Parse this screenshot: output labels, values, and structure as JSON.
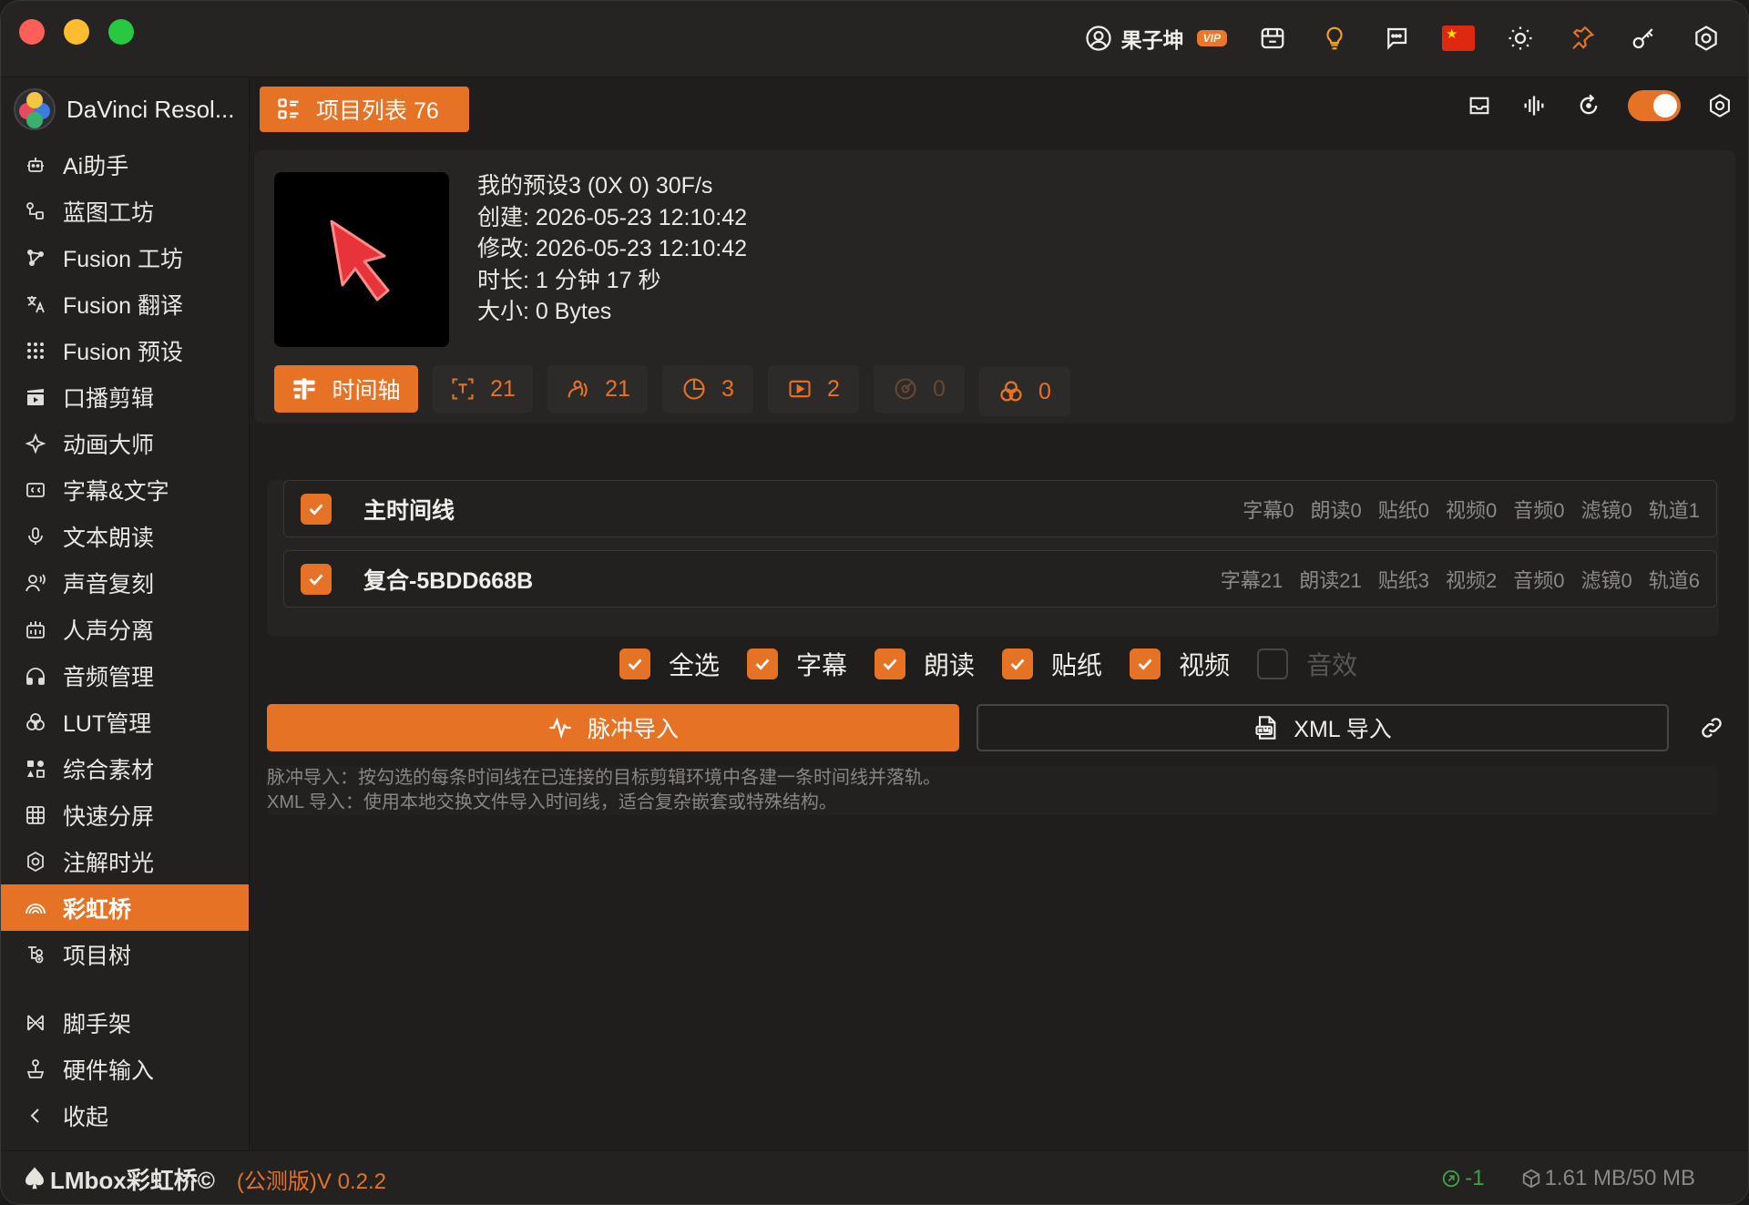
{
  "titlebar": {
    "user_name": "果子坤",
    "vip_label": "VIP"
  },
  "sidebar": {
    "app_name": "DaVinci Resol...",
    "items": [
      {
        "label": "Ai助手",
        "icon": "robot-icon"
      },
      {
        "label": "蓝图工坊",
        "icon": "blueprint-icon"
      },
      {
        "label": "Fusion 工坊",
        "icon": "fusion-workshop-icon"
      },
      {
        "label": "Fusion 翻译",
        "icon": "translate-icon"
      },
      {
        "label": "Fusion 预设",
        "icon": "preset-icon"
      },
      {
        "label": "口播剪辑",
        "icon": "clapper-icon"
      },
      {
        "label": "动画大师",
        "icon": "sparkle-icon"
      },
      {
        "label": "字幕&文字",
        "icon": "caption-icon"
      },
      {
        "label": "文本朗读",
        "icon": "microphone-icon"
      },
      {
        "label": "声音复刻",
        "icon": "voice-clone-icon"
      },
      {
        "label": "人声分离",
        "icon": "separator-icon"
      },
      {
        "label": "音频管理",
        "icon": "headphones-icon"
      },
      {
        "label": "LUT管理",
        "icon": "color-circles-icon"
      },
      {
        "label": "综合素材",
        "icon": "assets-icon"
      },
      {
        "label": "快速分屏",
        "icon": "grid-icon"
      },
      {
        "label": "注解时光",
        "icon": "annotation-icon"
      },
      {
        "label": "彩虹桥",
        "icon": "rainbow-icon"
      },
      {
        "label": "项目树",
        "icon": "tree-icon"
      }
    ],
    "bottom_items": [
      {
        "label": "脚手架",
        "icon": "scaffold-icon"
      },
      {
        "label": "硬件输入",
        "icon": "joystick-icon"
      },
      {
        "label": "收起",
        "icon": "chevron-left-icon"
      }
    ]
  },
  "topbar": {
    "project_list_label": "项目列表 76"
  },
  "project": {
    "meta": [
      "我的预设3 (0X 0) 30F/s",
      "创建: 2026-05-23 12:10:42",
      "修改: 2026-05-23 12:10:42",
      "时长: 1 分钟 17 秒",
      "大小: 0 Bytes"
    ],
    "timeline_label": "时间轴",
    "counts": {
      "subtitles": "21",
      "narration": "21",
      "stickers": "3",
      "videos": "2",
      "audio": "0",
      "filters": "0"
    }
  },
  "timelines": [
    {
      "name": "主时间线",
      "stats": [
        "字幕0",
        "朗读0",
        "贴纸0",
        "视频0",
        "音频0",
        "滤镜0",
        "轨道1"
      ]
    },
    {
      "name": "复合-5BDD668B",
      "stats": [
        "字幕21",
        "朗读21",
        "贴纸3",
        "视频2",
        "音频0",
        "滤镜0",
        "轨道6"
      ]
    }
  ],
  "filters": {
    "select_all": "全选",
    "subtitles": "字幕",
    "narration": "朗读",
    "stickers": "贴纸",
    "videos": "视频",
    "sfx": "音效"
  },
  "actions": {
    "pulse_import": "脉冲导入",
    "xml_import": "XML 导入"
  },
  "hints": [
    "脉冲导入：按勾选的每条时间线在已连接的目标剪辑环境中各建一条时间线并落轨。",
    "XML 导入：使用本地交换文件导入时间线，适合复杂嵌套或特殊结构。"
  ],
  "statusbar": {
    "brand": "LMbox彩虹桥©",
    "version": "(公测版)V 0.2.2",
    "connection": "-1",
    "memory": "1.61 MB/50 MB"
  },
  "colors": {
    "accent": "#e67225",
    "success": "#43a047"
  }
}
